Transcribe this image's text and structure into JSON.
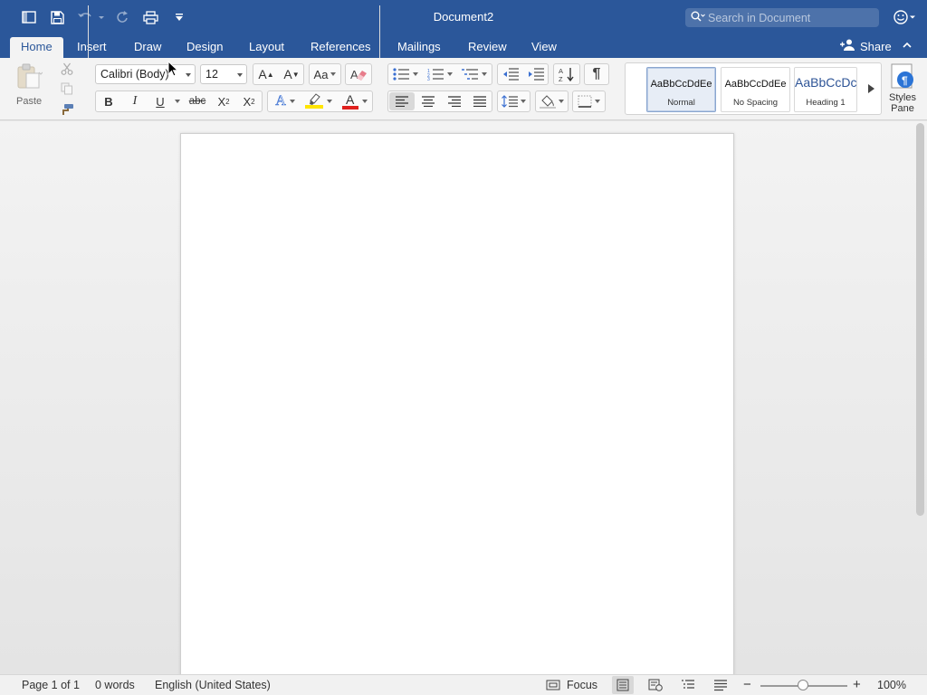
{
  "window": {
    "title": "Document2",
    "search_placeholder": "Search in Document"
  },
  "tabs": [
    {
      "label": "Home",
      "active": true
    },
    {
      "label": "Insert"
    },
    {
      "label": "Draw"
    },
    {
      "label": "Design"
    },
    {
      "label": "Layout"
    },
    {
      "label": "References"
    },
    {
      "label": "Mailings"
    },
    {
      "label": "Review"
    },
    {
      "label": "View"
    }
  ],
  "share_label": "Share",
  "ribbon": {
    "paste_label": "Paste",
    "font_name": "Calibri (Body)",
    "font_size": "12",
    "bold": "B",
    "italic": "I",
    "underline": "U",
    "strikethrough": "abc",
    "subscript": "X",
    "subscript_mark": "2",
    "superscript": "X",
    "superscript_mark": "2",
    "grow_font": "A",
    "shrink_font": "A",
    "change_case": "Aa",
    "font_color_letter": "A",
    "effects_letter": "A",
    "pilcrow": "¶",
    "sort_a": "A",
    "sort_z": "Z"
  },
  "styles": [
    {
      "preview": "AaBbCcDdEe",
      "name": "Normal",
      "selected": true
    },
    {
      "preview": "AaBbCcDdEe",
      "name": "No Spacing"
    },
    {
      "preview": "AaBbCcDc",
      "name": "Heading 1"
    }
  ],
  "styles_pane_label": "Styles\nPane",
  "status": {
    "page": "Page 1 of 1",
    "words": "0 words",
    "language": "English (United States)",
    "focus": "Focus",
    "zoom": "100%",
    "zoom_minus": "−",
    "zoom_plus": "+"
  },
  "colors": {
    "titlebar": "#2b579a",
    "highlight": "#ffe500",
    "font_color": "#e0201e"
  }
}
